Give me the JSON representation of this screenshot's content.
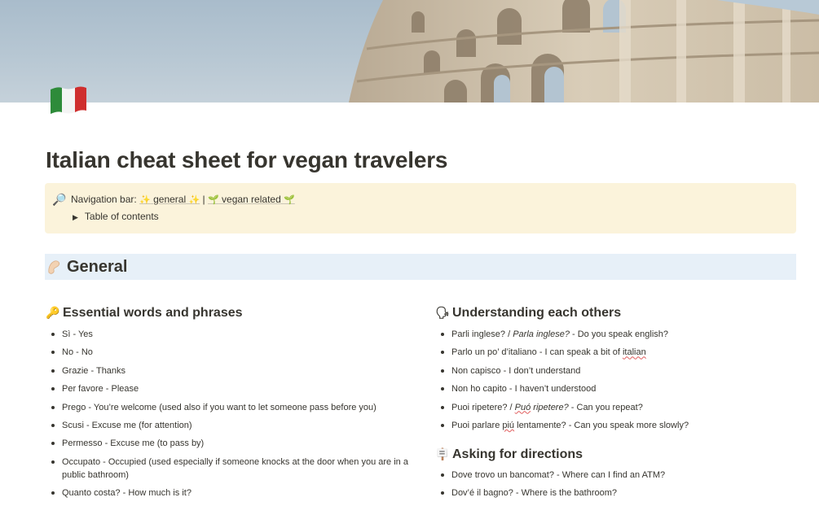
{
  "page": {
    "title": "Italian cheat sheet for vegan travelers",
    "icon": "italy-flag-icon"
  },
  "callout": {
    "icon": "magnifying-glass-icon",
    "nav_prefix": "Navigation bar: ",
    "link_general": "general",
    "separator": "|",
    "link_vegan": "vegan related",
    "toc_label": "Table of contents"
  },
  "section_general": {
    "icon": "pinching-hand-icon",
    "title": "General"
  },
  "essential": {
    "icon": "key-icon",
    "heading": "Essential words and phrases",
    "items": [
      "Sì - Yes",
      "No - No",
      "Grazie - Thanks",
      "Per favore - Please",
      "Prego - You’re welcome (used also if you want to let someone pass before you)",
      "Scusi - Excuse me (for attention)",
      "Permesso - Excuse me (to pass by)",
      "Occupato - Occupied (used especially if someone knocks at the door when you are in a public bathroom)",
      "Quanto costa? - How much is it?"
    ]
  },
  "understanding": {
    "icon": "speaking-head-icon",
    "heading": "Understanding each others",
    "item1_a": "Parli inglese? / ",
    "item1_b": "Parla inglese?",
    "item1_c": " - Do you speak english?",
    "item2_a": "Parlo un po’ d’italiano - I can speak a bit of ",
    "item2_b": "italian",
    "item3": "Non capisco - I don’t understand",
    "item4": "Non ho capito - I haven’t understood",
    "item5_a": "Puoi ripetere? / ",
    "item5_b": "Puó",
    "item5_c": " ripetere?",
    "item5_d": " - Can you repeat?",
    "item6_a": "Puoi parlare ",
    "item6_b": "piú",
    "item6_c": " lentamente? - Can you speak more slowly?"
  },
  "directions": {
    "icon": "signpost-icon",
    "heading": "Asking for directions",
    "items": [
      "Dove trovo un bancomat? - Where can I find an ATM?",
      "Dov’é il bagno? - Where is the bathroom?"
    ]
  }
}
